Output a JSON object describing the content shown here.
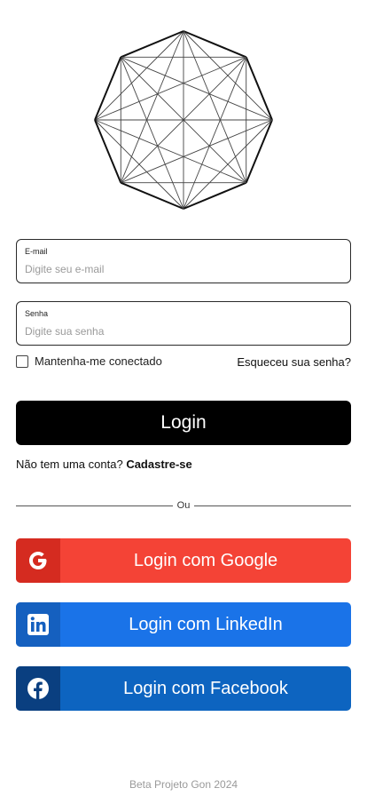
{
  "form": {
    "email": {
      "label": "E-mail",
      "placeholder": "Digite seu e-mail",
      "value": ""
    },
    "password": {
      "label": "Senha",
      "placeholder": "Digite sua senha",
      "value": ""
    },
    "remember_label": "Mantenha-me conectado",
    "remember_checked": false,
    "forgot_label": "Esqueceu sua senha?",
    "login_label": "Login"
  },
  "signup": {
    "prompt": "Não tem uma conta?",
    "link": "Cadastre-se"
  },
  "divider_label": "Ou",
  "social": {
    "google": {
      "label": "Login com Google",
      "icon": "google-icon",
      "color": "#f44336"
    },
    "linkedin": {
      "label": "Login com LinkedIn",
      "icon": "linkedin-icon",
      "color": "#1a73e8"
    },
    "facebook": {
      "label": "Login com Facebook",
      "icon": "facebook-icon",
      "color": "#0d64c0"
    }
  },
  "footer": "Beta Projeto Gon 2024"
}
